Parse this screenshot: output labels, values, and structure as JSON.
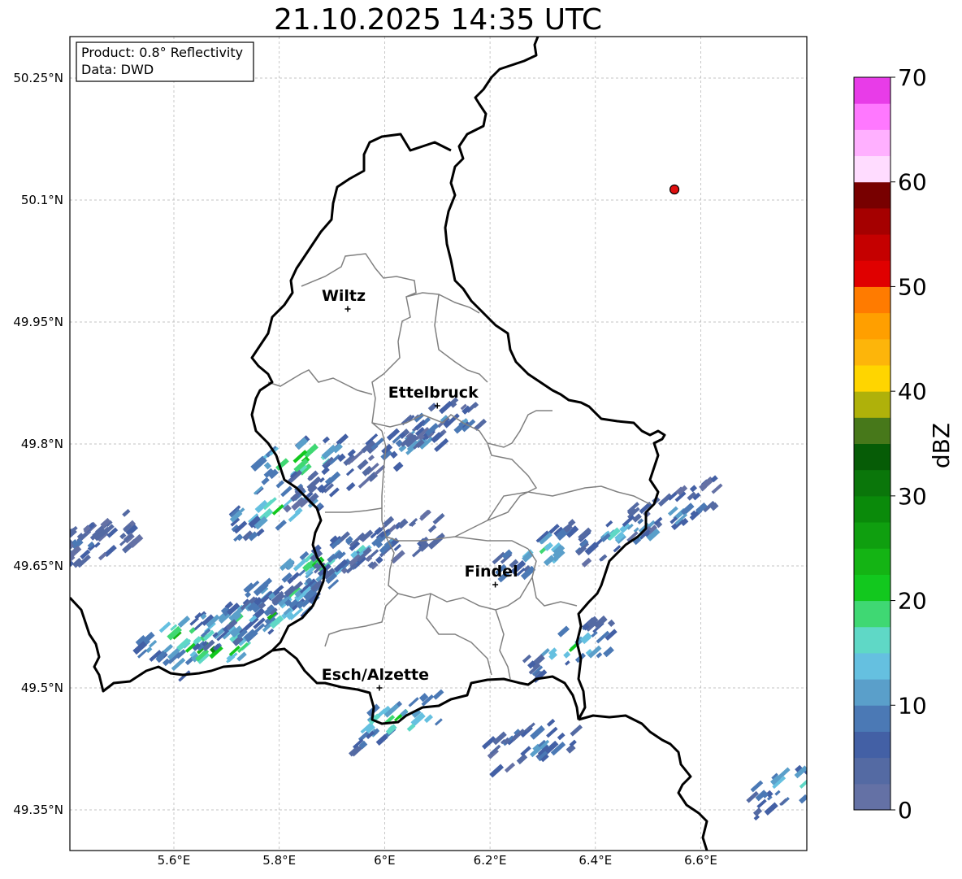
{
  "title": "21.10.2025 14:35 UTC",
  "info": {
    "product": "Product: 0.8° Reflectivity",
    "data": "Data: DWD"
  },
  "axes": {
    "lon_labels": [
      "5.6°E",
      "5.8°E",
      "6°E",
      "6.2°E",
      "6.4°E",
      "6.6°E"
    ],
    "lat_labels": [
      "50.25°N",
      "50.1°N",
      "49.95°N",
      "49.8°N",
      "49.65°N",
      "49.5°N",
      "49.35°N"
    ]
  },
  "cities": [
    {
      "name": "Wiltz",
      "lon": 5.93,
      "lat": 49.966
    },
    {
      "name": "Ettelbruck",
      "lon": 6.1,
      "lat": 49.847
    },
    {
      "name": "Findel",
      "lon": 6.21,
      "lat": 49.627
    },
    {
      "name": "Esch/Alzette",
      "lon": 5.99,
      "lat": 49.5
    }
  ],
  "marker": {
    "name": "radar-site",
    "lon": 6.55,
    "lat": 50.11,
    "color": "#e01010"
  },
  "colorbar": {
    "label": "dBZ",
    "ticks": [
      "0",
      "10",
      "20",
      "30",
      "40",
      "50",
      "60",
      "70"
    ],
    "colors": [
      "#6471a5",
      "#546aa3",
      "#4360a5",
      "#4b79b5",
      "#5a9fca",
      "#65c0e0",
      "#5fd8c6",
      "#3fd873",
      "#12c81e",
      "#14b414",
      "#0f9f0f",
      "#0a8a0a",
      "#0a760a",
      "#065c06",
      "#47781a",
      "#afb10a",
      "#ffd500",
      "#fdb50a",
      "#ff9f00",
      "#ff7b00",
      "#e00000",
      "#c50000",
      "#a50000",
      "#780000",
      "#ffdcff",
      "#ffb0ff",
      "#ff78ff",
      "#e83ce8"
    ]
  },
  "chart_data": {
    "type": "heatmap",
    "title": "21.10.2025 14:35 UTC",
    "xlabel": "",
    "ylabel": "",
    "xlim": [
      5.4,
      6.8
    ],
    "ylim": [
      49.28,
      50.3
    ],
    "colorbar_label": "dBZ",
    "colorbar_range": [
      0,
      70
    ],
    "echoes": [
      {
        "lon": 5.4,
        "lat": 49.67,
        "dbz": 12
      },
      {
        "lon": 5.45,
        "lat": 49.68,
        "dbz": 8
      },
      {
        "lon": 5.62,
        "lat": 49.56,
        "dbz": 28
      },
      {
        "lon": 5.68,
        "lat": 49.55,
        "dbz": 30
      },
      {
        "lon": 5.72,
        "lat": 49.58,
        "dbz": 20
      },
      {
        "lon": 5.78,
        "lat": 49.59,
        "dbz": 22
      },
      {
        "lon": 5.82,
        "lat": 49.62,
        "dbz": 18
      },
      {
        "lon": 5.88,
        "lat": 49.65,
        "dbz": 22
      },
      {
        "lon": 5.95,
        "lat": 49.67,
        "dbz": 14
      },
      {
        "lon": 6.02,
        "lat": 49.68,
        "dbz": 10
      },
      {
        "lon": 5.8,
        "lat": 49.72,
        "dbz": 24
      },
      {
        "lon": 5.84,
        "lat": 49.78,
        "dbz": 26
      },
      {
        "lon": 5.9,
        "lat": 49.76,
        "dbz": 8
      },
      {
        "lon": 6.05,
        "lat": 49.8,
        "dbz": 12
      },
      {
        "lon": 6.12,
        "lat": 49.83,
        "dbz": 10
      },
      {
        "lon": 6.3,
        "lat": 49.67,
        "dbz": 18
      },
      {
        "lon": 6.45,
        "lat": 49.69,
        "dbz": 16
      },
      {
        "lon": 6.55,
        "lat": 49.72,
        "dbz": 12
      },
      {
        "lon": 6.35,
        "lat": 49.55,
        "dbz": 20
      },
      {
        "lon": 6.28,
        "lat": 49.43,
        "dbz": 12
      },
      {
        "lon": 6.02,
        "lat": 49.46,
        "dbz": 22
      },
      {
        "lon": 6.78,
        "lat": 49.38,
        "dbz": 20
      }
    ]
  }
}
